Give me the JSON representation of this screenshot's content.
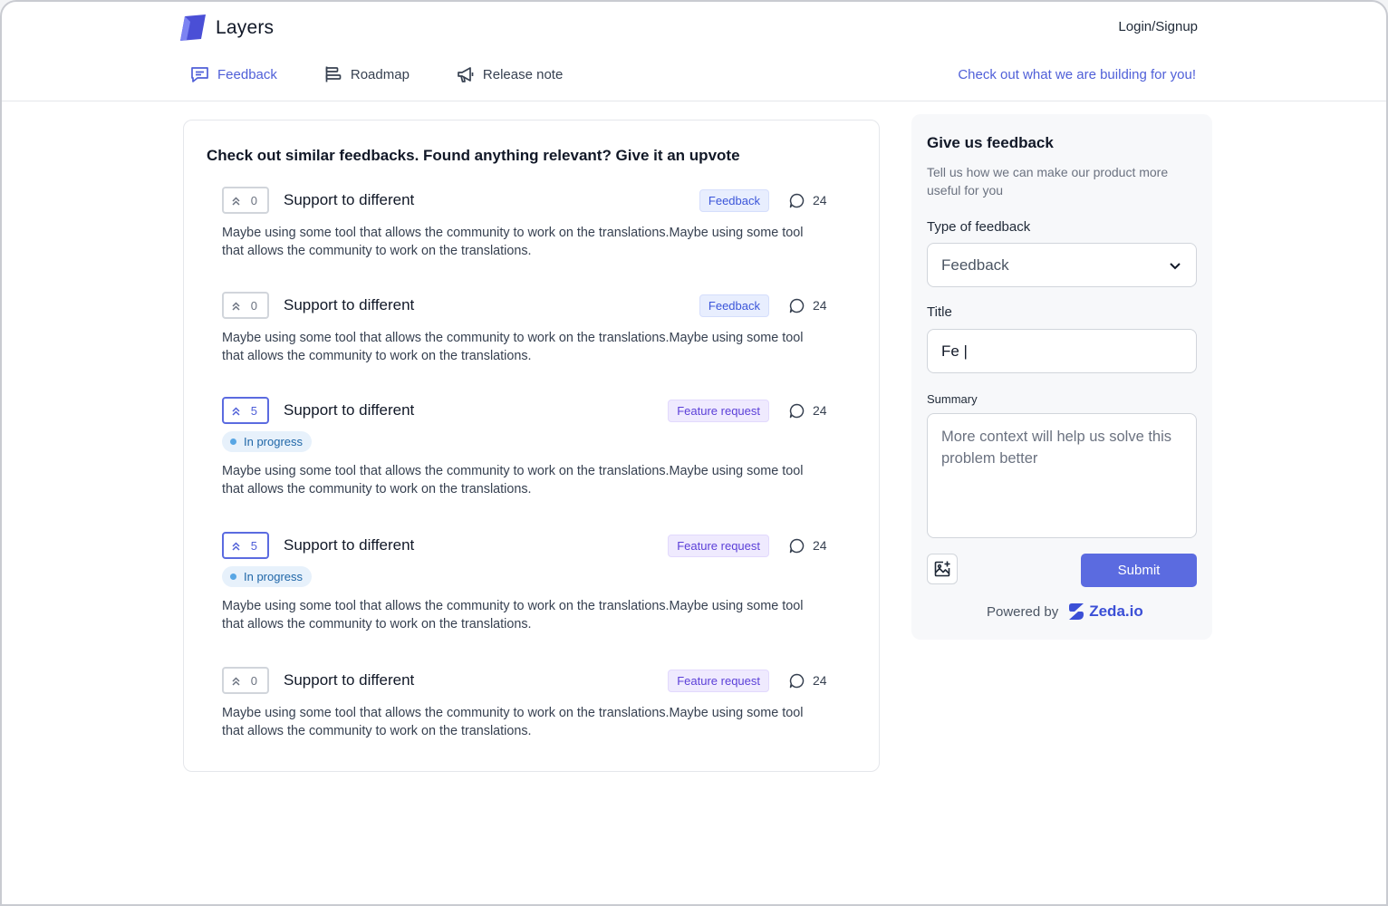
{
  "brand": {
    "name": "Layers",
    "accent": "#5b6be0"
  },
  "header": {
    "login_label": "Login/Signup",
    "nav": [
      {
        "label": "Feedback",
        "icon": "message-square-icon",
        "active": true
      },
      {
        "label": "Roadmap",
        "icon": "roadmap-bars-icon",
        "active": false
      },
      {
        "label": "Release note",
        "icon": "megaphone-icon",
        "active": false
      }
    ],
    "cta_link": "Check out what we are building for you!"
  },
  "similar": {
    "heading": "Check out similar feedbacks. Found anything relevant? Give it an upvote",
    "items": [
      {
        "votes": "0",
        "title": "Support to different",
        "tag": "Feedback",
        "comments": "24",
        "status": null,
        "description": "Maybe using some tool that allows the community to work on the translations.Maybe using some tool that allows the community to work on the translations."
      },
      {
        "votes": "0",
        "title": "Support to different",
        "tag": "Feedback",
        "comments": "24",
        "status": null,
        "description": "Maybe using some tool that allows the community to work on the translations.Maybe using some tool that allows the community to work on the translations."
      },
      {
        "votes": "5",
        "title": "Support to different",
        "tag": "Feature request",
        "comments": "24",
        "status": "In progress",
        "description": "Maybe using some tool that allows the community to work on the translations.Maybe using some tool that allows the community to work on the translations."
      },
      {
        "votes": "5",
        "title": "Support to different",
        "tag": "Feature request",
        "comments": "24",
        "status": "In progress",
        "description": "Maybe using some tool that allows the community to work on the translations.Maybe using some tool that allows the community to work on the translations."
      },
      {
        "votes": "0",
        "title": "Support to different",
        "tag": "Feature request",
        "comments": "24",
        "status": null,
        "description": "Maybe using some tool that allows the community to work on the translations.Maybe using some tool that allows the community to work on the translations."
      }
    ]
  },
  "form": {
    "title": "Give us feedback",
    "subtitle": "Tell us how we can make our product more useful for you",
    "type_label": "Type of feedback",
    "type_value": "Feedback",
    "title_label": "Title",
    "title_value": "Fe |",
    "summary_label": "Summary",
    "summary_placeholder": "More context will help us solve this problem better",
    "submit_label": "Submit",
    "powered_by": "Powered by",
    "powered_brand": "Zeda.io"
  }
}
